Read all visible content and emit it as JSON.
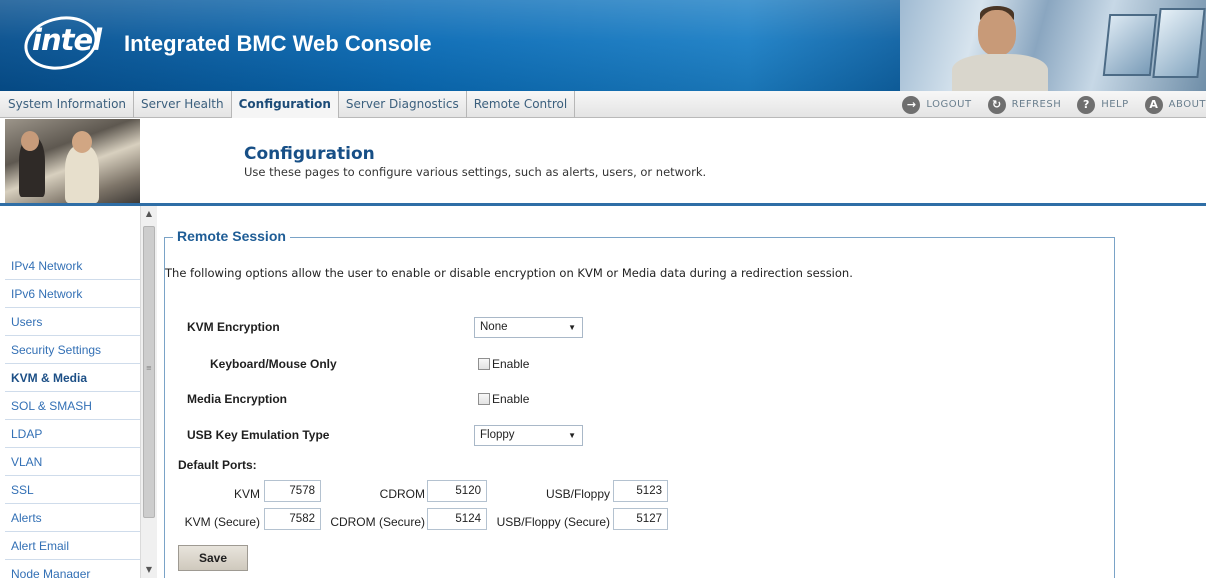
{
  "banner": {
    "logo_text": "intel",
    "title": "Integrated BMC Web Console"
  },
  "nav": {
    "tabs": [
      {
        "label": "System Information"
      },
      {
        "label": "Server Health"
      },
      {
        "label": "Configuration"
      },
      {
        "label": "Server Diagnostics"
      },
      {
        "label": "Remote Control"
      }
    ],
    "active_tab": "Configuration",
    "actions": [
      {
        "label": "LOGOUT",
        "icon": "logout-icon"
      },
      {
        "label": "REFRESH",
        "icon": "refresh-icon"
      },
      {
        "label": "HELP",
        "icon": "help-icon"
      },
      {
        "label": "ABOUT",
        "icon": "about-icon"
      }
    ]
  },
  "header": {
    "title": "Configuration",
    "description": "Use these pages to configure various settings, such as alerts, users, or network."
  },
  "sidebar": {
    "items": [
      {
        "label": "IPv4 Network"
      },
      {
        "label": "IPv6 Network"
      },
      {
        "label": "Users"
      },
      {
        "label": "Security Settings"
      },
      {
        "label": "KVM & Media"
      },
      {
        "label": "SOL & SMASH"
      },
      {
        "label": "LDAP"
      },
      {
        "label": "VLAN"
      },
      {
        "label": "SSL"
      },
      {
        "label": "Alerts"
      },
      {
        "label": "Alert Email"
      },
      {
        "label": "Node Manager"
      }
    ],
    "active_item": "KVM & Media"
  },
  "panel": {
    "legend": "Remote Session",
    "intro": "The following options allow the user to enable or disable encryption on KVM or Media data during a redirection session.",
    "kvm_encryption": {
      "label": "KVM Encryption",
      "value": "None"
    },
    "keyboard_mouse_only": {
      "label": "Keyboard/Mouse Only",
      "checkbox_label": "Enable",
      "checked": false
    },
    "media_encryption": {
      "label": "Media Encryption",
      "checkbox_label": "Enable",
      "checked": false
    },
    "usb_key_emulation": {
      "label": "USB Key Emulation Type",
      "value": "Floppy"
    },
    "default_ports_label": "Default Ports:",
    "ports": {
      "kvm": {
        "label": "KVM",
        "value": "7578"
      },
      "cdrom": {
        "label": "CDROM",
        "value": "5120"
      },
      "usb_floppy": {
        "label": "USB/Floppy",
        "value": "5123"
      },
      "kvm_secure": {
        "label": "KVM (Secure)",
        "value": "7582"
      },
      "cdrom_secure": {
        "label": "CDROM (Secure)",
        "value": "5124"
      },
      "usb_floppy_secure": {
        "label": "USB/Floppy (Secure)",
        "value": "5127"
      }
    },
    "save_label": "Save"
  },
  "colors": {
    "banner_blue": "#0a6bb5",
    "link_blue": "#3370b5",
    "heading_blue": "#174f86"
  }
}
